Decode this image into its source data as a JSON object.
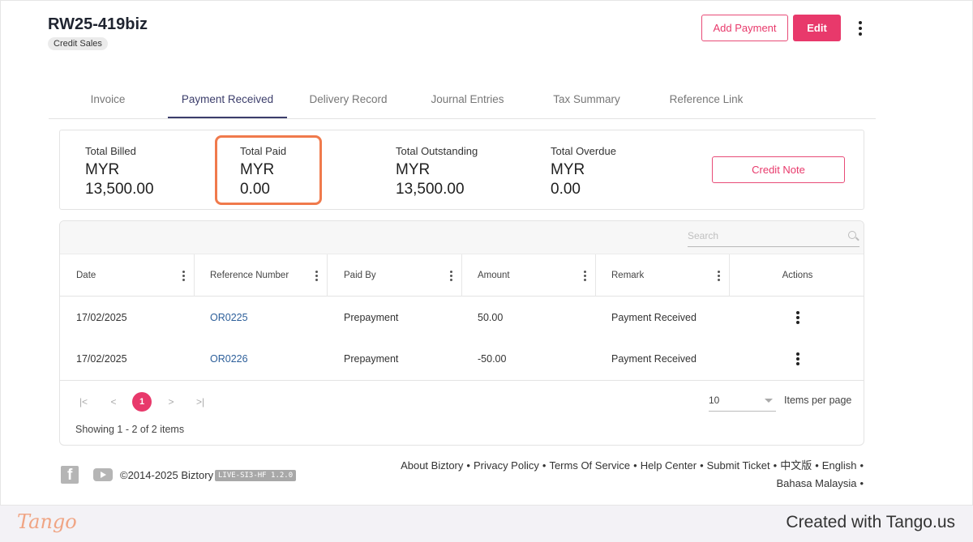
{
  "header": {
    "title": "RW25-419biz",
    "badge": "Credit Sales",
    "add_payment_label": "Add Payment",
    "edit_label": "Edit"
  },
  "tabs": [
    {
      "label": "Invoice",
      "active": false
    },
    {
      "label": "Payment Received",
      "active": true
    },
    {
      "label": "Delivery Record",
      "active": false
    },
    {
      "label": "Journal Entries",
      "active": false
    },
    {
      "label": "Tax Summary",
      "active": false
    },
    {
      "label": "Reference Link",
      "active": false
    }
  ],
  "summary": {
    "items": [
      {
        "label": "Total Billed",
        "currency": "MYR",
        "amount": "13,500.00"
      },
      {
        "label": "Total Paid",
        "currency": "MYR",
        "amount": "0.00"
      },
      {
        "label": "Total Outstanding",
        "currency": "MYR",
        "amount": "13,500.00"
      },
      {
        "label": "Total Overdue",
        "currency": "MYR",
        "amount": "0.00"
      }
    ],
    "credit_note_label": "Credit Note"
  },
  "table": {
    "search_placeholder": "Search",
    "columns": [
      "Date",
      "Reference Number",
      "Paid By",
      "Amount",
      "Remark",
      "Actions"
    ],
    "rows": [
      {
        "date": "17/02/2025",
        "reference": "OR0225",
        "paid_by": "Prepayment",
        "amount": "50.00",
        "remark": "Payment Received"
      },
      {
        "date": "17/02/2025",
        "reference": "OR0226",
        "paid_by": "Prepayment",
        "amount": "-50.00",
        "remark": "Payment Received"
      }
    ],
    "pagination": {
      "first": "|<",
      "prev": "<",
      "current_page": "1",
      "next": ">",
      "last": ">|",
      "page_size": "10",
      "page_size_label": "Items per page",
      "showing": "Showing 1 - 2 of 2 items"
    }
  },
  "footer": {
    "copyright": "©2014-2025 Biztory",
    "version": "LIVE-SI3-HF 1.2.0",
    "links": [
      "About Biztory",
      "Privacy Policy",
      "Terms Of Service",
      "Help Center",
      "Submit Ticket",
      "中文版",
      "English",
      "Bahasa Malaysia"
    ],
    "separator": "•"
  },
  "watermark": {
    "logo": "Tango",
    "credit": "Created with Tango.us"
  },
  "colors": {
    "accent": "#e8396b",
    "tab_active": "#3b3d6b",
    "highlight": "#f07a4c",
    "link": "#2d5f9a"
  }
}
